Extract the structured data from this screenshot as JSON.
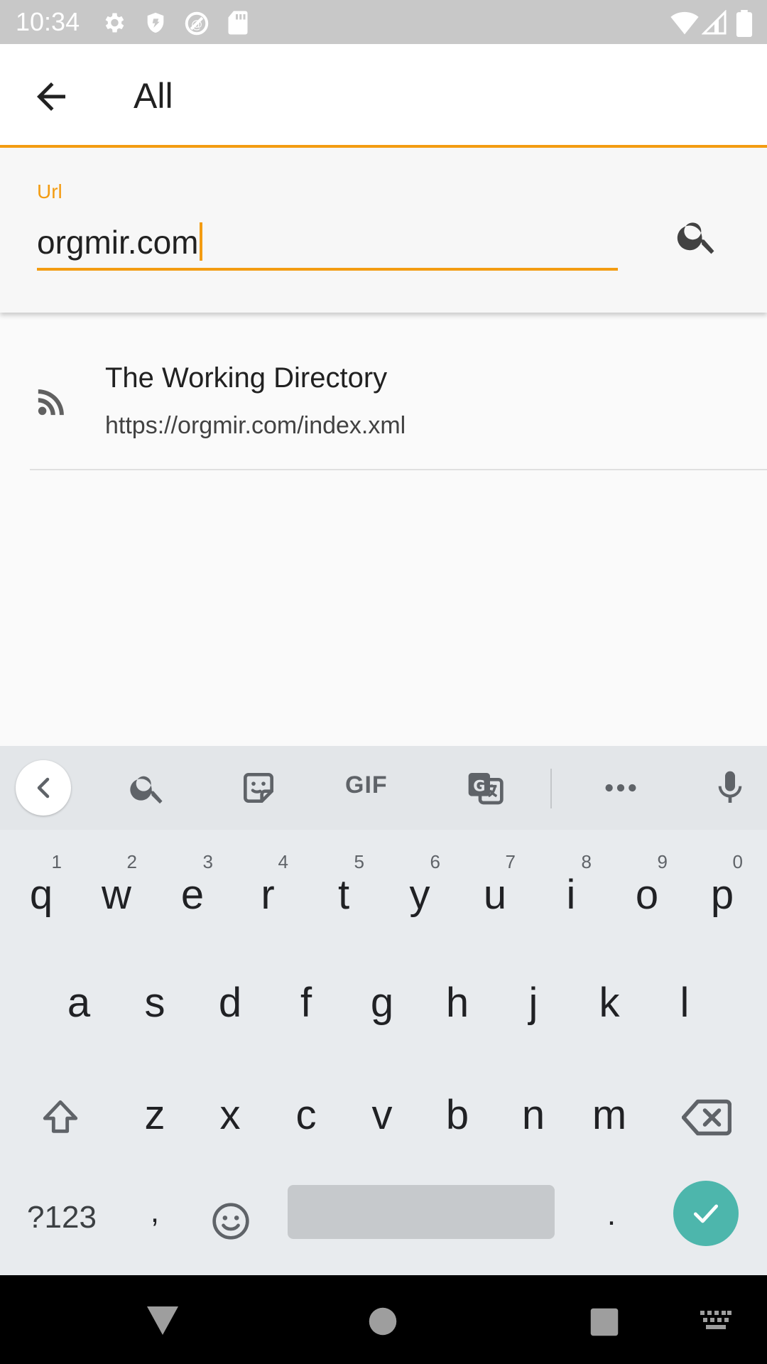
{
  "status_bar": {
    "time": "10:34"
  },
  "app_bar": {
    "title": "All"
  },
  "search": {
    "label": "Url",
    "value": "orgmir.com"
  },
  "results": [
    {
      "title": "The Working Directory",
      "url": "https://orgmir.com/index.xml"
    }
  ],
  "keyboard": {
    "toolbar": [
      "collapse-icon",
      "search-icon",
      "sticker-icon",
      "gif-icon",
      "translate-icon",
      "more-icon",
      "mic-icon"
    ],
    "gif_label": "GIF",
    "row1": [
      {
        "char": "q",
        "hint": "1"
      },
      {
        "char": "w",
        "hint": "2"
      },
      {
        "char": "e",
        "hint": "3"
      },
      {
        "char": "r",
        "hint": "4"
      },
      {
        "char": "t",
        "hint": "5"
      },
      {
        "char": "y",
        "hint": "6"
      },
      {
        "char": "u",
        "hint": "7"
      },
      {
        "char": "i",
        "hint": "8"
      },
      {
        "char": "o",
        "hint": "9"
      },
      {
        "char": "p",
        "hint": "0"
      }
    ],
    "row2": [
      "a",
      "s",
      "d",
      "f",
      "g",
      "h",
      "j",
      "k",
      "l"
    ],
    "row3": [
      "z",
      "x",
      "c",
      "v",
      "b",
      "n",
      "m"
    ],
    "row4": {
      "symbols": "?123",
      "comma": ",",
      "period": "."
    }
  },
  "colors": {
    "accent": "#f39c12",
    "enter": "#4db6ac",
    "status_bar": "#c8c8c8"
  }
}
